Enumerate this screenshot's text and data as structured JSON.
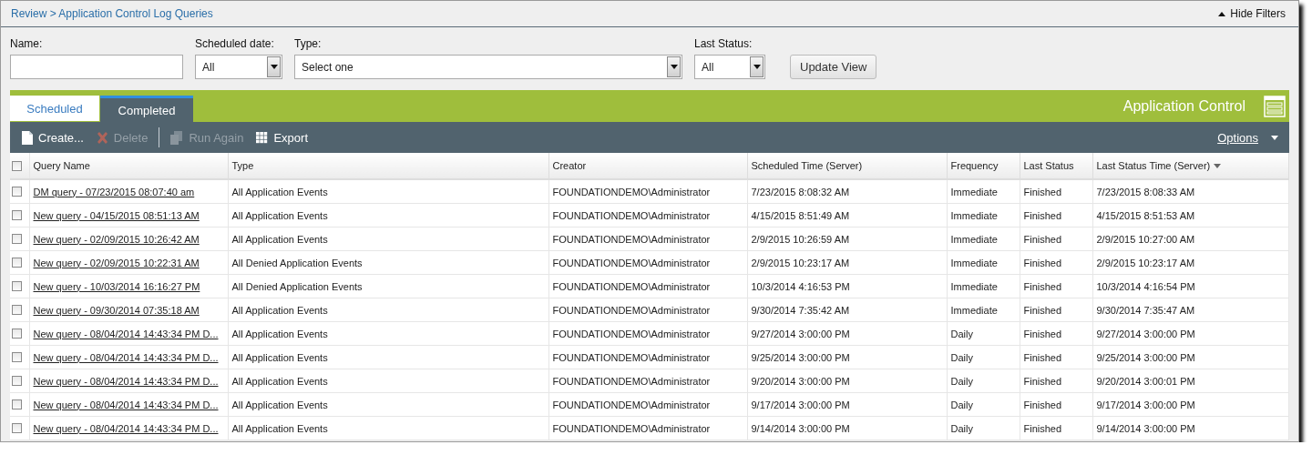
{
  "breadcrumb": {
    "items": [
      "Review",
      "Application Control Log Queries"
    ],
    "separator": ">"
  },
  "hide_filters": {
    "label": "Hide Filters",
    "expanded": true
  },
  "filters": [
    {
      "kind": "text",
      "label": "Name:"
    },
    {
      "kind": "select",
      "label": "Scheduled date:",
      "value": "All"
    },
    {
      "kind": "select",
      "label": "Type:",
      "value": "Select one"
    },
    {
      "kind": "select",
      "label": "Last Status:",
      "value": "All"
    }
  ],
  "update_button": "Update View",
  "tabs": [
    {
      "label": "Scheduled",
      "selected": false
    },
    {
      "label": "Completed",
      "selected": true
    }
  ],
  "section_title": "Application Control",
  "toolbar": [
    {
      "kind": "create",
      "label": "Create...",
      "disabled": false
    },
    {
      "kind": "delete",
      "label": "Delete",
      "disabled": true
    },
    {
      "kind": "run",
      "label": "Run Again",
      "disabled": true
    },
    {
      "kind": "export",
      "label": "Export",
      "disabled": false
    }
  ],
  "options": "Options",
  "table": {
    "select_all_checked": false,
    "columns": [
      {
        "label": "Query Name",
        "sorted": false
      },
      {
        "label": "Type",
        "sorted": false
      },
      {
        "label": "Creator",
        "sorted": false
      },
      {
        "label": "Scheduled Time (Server)",
        "sorted": false
      },
      {
        "label": "Frequency",
        "sorted": false
      },
      {
        "label": "Last Status",
        "sorted": false
      },
      {
        "label": "Last Status Time (Server)",
        "sorted": true
      }
    ],
    "rows": [
      {
        "checked": false,
        "cells": [
          "DM query - 07/23/2015 08:07:40 am",
          "All Application Events",
          "FOUNDATIONDEMO\\Administrator",
          "7/23/2015 8:08:32 AM",
          "Immediate",
          "Finished",
          "7/23/2015 8:08:33 AM"
        ]
      },
      {
        "checked": false,
        "cells": [
          "New query - 04/15/2015 08:51:13 AM",
          "All Application Events",
          "FOUNDATIONDEMO\\Administrator",
          "4/15/2015 8:51:49 AM",
          "Immediate",
          "Finished",
          "4/15/2015 8:51:53 AM"
        ]
      },
      {
        "checked": false,
        "cells": [
          "New query - 02/09/2015 10:26:42 AM",
          "All Application Events",
          "FOUNDATIONDEMO\\Administrator",
          "2/9/2015 10:26:59 AM",
          "Immediate",
          "Finished",
          "2/9/2015 10:27:00 AM"
        ]
      },
      {
        "checked": false,
        "cells": [
          "New query - 02/09/2015 10:22:31 AM",
          "All Denied Application Events",
          "FOUNDATIONDEMO\\Administrator",
          "2/9/2015 10:23:17 AM",
          "Immediate",
          "Finished",
          "2/9/2015 10:23:17 AM"
        ]
      },
      {
        "checked": false,
        "cells": [
          "New query - 10/03/2014 16:16:27 PM",
          "All Denied Application Events",
          "FOUNDATIONDEMO\\Administrator",
          "10/3/2014 4:16:53 PM",
          "Immediate",
          "Finished",
          "10/3/2014 4:16:54 PM"
        ]
      },
      {
        "checked": false,
        "cells": [
          "New query - 09/30/2014 07:35:18 AM",
          "All Application Events",
          "FOUNDATIONDEMO\\Administrator",
          "9/30/2014 7:35:42 AM",
          "Immediate",
          "Finished",
          "9/30/2014 7:35:47 AM"
        ]
      },
      {
        "checked": false,
        "cells": [
          "New query - 08/04/2014 14:43:34 PM D...",
          "All Application Events",
          "FOUNDATIONDEMO\\Administrator",
          "9/27/2014 3:00:00 PM",
          "Daily",
          "Finished",
          "9/27/2014 3:00:00 PM"
        ]
      },
      {
        "checked": false,
        "cells": [
          "New query - 08/04/2014 14:43:34 PM D...",
          "All Application Events",
          "FOUNDATIONDEMO\\Administrator",
          "9/25/2014 3:00:00 PM",
          "Daily",
          "Finished",
          "9/25/2014 3:00:00 PM"
        ]
      },
      {
        "checked": false,
        "cells": [
          "New query - 08/04/2014 14:43:34 PM D...",
          "All Application Events",
          "FOUNDATIONDEMO\\Administrator",
          "9/20/2014 3:00:00 PM",
          "Daily",
          "Finished",
          "9/20/2014 3:00:01 PM"
        ]
      },
      {
        "checked": false,
        "cells": [
          "New query - 08/04/2014 14:43:34 PM D...",
          "All Application Events",
          "FOUNDATIONDEMO\\Administrator",
          "9/17/2014 3:00:00 PM",
          "Daily",
          "Finished",
          "9/17/2014 3:00:00 PM"
        ]
      },
      {
        "checked": false,
        "cells": [
          "New query - 08/04/2014 14:43:34 PM D...",
          "All Application Events",
          "FOUNDATIONDEMO\\Administrator",
          "9/14/2014 3:00:00 PM",
          "Daily",
          "Finished",
          "9/14/2014 3:00:00 PM"
        ]
      }
    ]
  }
}
